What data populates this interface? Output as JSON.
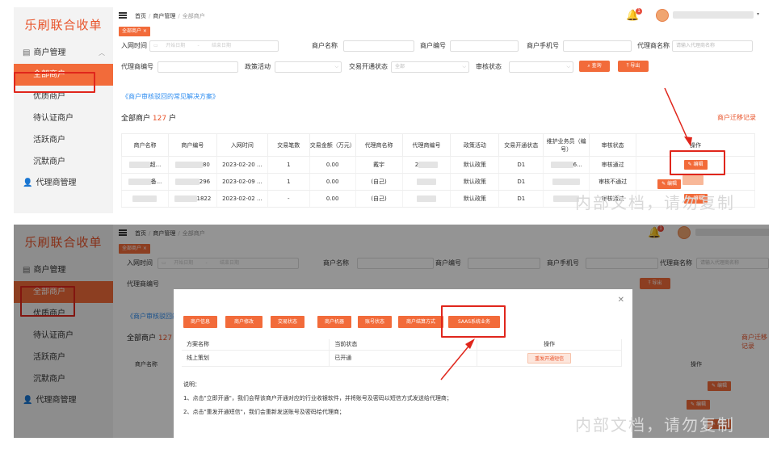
{
  "app": {
    "logo": "乐刷联合收单"
  },
  "sidebar": {
    "groups": [
      {
        "label": "商户管理",
        "items": [
          "全部商户",
          "优质商户",
          "待认证商户",
          "活跃商户",
          "沉默商户"
        ]
      },
      {
        "label": "代理商管理"
      }
    ]
  },
  "header": {
    "breadcrumb": [
      "首页",
      "商户管理",
      "全部商户"
    ],
    "notification_count": "1"
  },
  "tabbar": {
    "active_tab": "全部商户"
  },
  "filters": {
    "join_time_label": "入网时间",
    "start_date_placeholder": "开始日期",
    "date_sep": "-",
    "end_date_placeholder": "结束日期",
    "merchant_name_label": "商户名称",
    "merchant_no_label": "商户编号",
    "merchant_phone_label": "商户手机号",
    "agent_name_label": "代理商名称",
    "agent_name_placeholder": "请输入代理商名称",
    "agent_no_label": "代理商编号",
    "policy_label": "政策活动",
    "trade_status_label": "交易开通状态",
    "trade_status_value": "全部",
    "audit_status_label": "审核状态",
    "query_button": "查询",
    "export_button": "导出"
  },
  "faq_link": "《商户审核驳回的常见解决方案》",
  "summary": {
    "prefix": "全部商户",
    "count": "127",
    "suffix": "户"
  },
  "migrate_link": "商户迁移记录",
  "table": {
    "columns": [
      "商户名称",
      "商户编号",
      "入网时间",
      "交易笔数",
      "交易金额（万元）",
      "代理商名称",
      "代理商编号",
      "政策活动",
      "交易开通状态",
      "维护业务员（编号）",
      "审核状态",
      "操作"
    ],
    "rows": [
      {
        "name_tail": "超...",
        "no_tail": "80",
        "date": "2023-02-20 ...",
        "count": "1",
        "amount": "0.00",
        "agent": "戴宇",
        "agent_no": "2",
        "policy": "默认政策",
        "open": "D1",
        "staff_tail": "6...",
        "audit": "审核通过",
        "action": "编辑"
      },
      {
        "name_tail": "备...",
        "no_tail": "296",
        "date": "2023-02-09 ...",
        "count": "1",
        "amount": "0.00",
        "agent": "(自己)",
        "agent_no": "",
        "policy": "默认政策",
        "open": "D1",
        "staff_tail": "",
        "audit": "审核不通过",
        "action": "编辑"
      },
      {
        "name_tail": "",
        "no_tail": "1822",
        "date": "2023-02-02 ...",
        "count": "-",
        "amount": "0.00",
        "agent": "(自己)",
        "agent_no": "",
        "policy": "默认政策",
        "open": "D1",
        "staff_tail": "",
        "audit": "审核通过",
        "action": "编辑"
      }
    ]
  },
  "modal": {
    "tabs": [
      "商户信息",
      "商户修改",
      "交易状态",
      "商户机器",
      "账号状态",
      "商户结算方式",
      "SAAS系统业务"
    ],
    "columns": [
      "方案名称",
      "当前状态",
      "操作"
    ],
    "rows": [
      {
        "plan": "线上策划",
        "status": "已开通",
        "action": "重发开通短信"
      }
    ],
    "notes_title": "说明：",
    "notes": [
      "1、点击\"立即开通\"，我们会帮该商户开通对应的行业收银软件，并将账号及密码以短信方式发送给代理商；",
      "2、点击\"重发开通短信\"，我们会重新发送账号及密码给代理商；"
    ]
  },
  "watermark": "内部文档，请勿复制",
  "colors": {
    "accent": "#f26b3a",
    "logo": "#e8532a",
    "highlight": "#e0261c",
    "link": "#2d8cf0"
  }
}
